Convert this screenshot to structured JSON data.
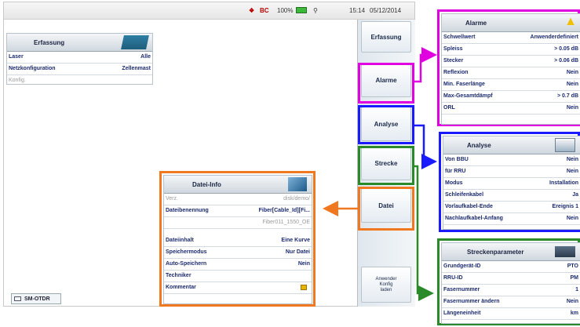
{
  "status": {
    "icons_text": "BC",
    "battery": "100%",
    "time": "15:14",
    "date": "05/12/2014"
  },
  "side_buttons": {
    "erfassung": "Erfassung",
    "alarme": "Alarme",
    "analyse": "Analyse",
    "strecke": "Strecke",
    "datei": "Datei",
    "anwender": "Anwender\nKonfig\nladen"
  },
  "erfassung_panel": {
    "title": "Erfassung",
    "rows": [
      {
        "k": "Laser",
        "v": "Alle"
      },
      {
        "k": "Netzkonfiguration",
        "v": "Zellenmast"
      },
      {
        "k": "Konfig.",
        "v": ""
      }
    ]
  },
  "datei_panel": {
    "title": "Datei-Info",
    "verz_label": "Verz.",
    "verz_value": "disk/demo/",
    "rows": [
      {
        "k": "Dateibenennung",
        "v": "Fiber[Cable_Id][Fi..."
      },
      {
        "k": "",
        "v": "Fiber011_1550_OE"
      },
      {
        "k": "Dateiinhalt",
        "v": "Eine Kurve"
      },
      {
        "k": "Speichermodus",
        "v": "Nur Datei"
      },
      {
        "k": "Auto-Speichern",
        "v": "Nein"
      },
      {
        "k": "Techniker",
        "v": ""
      },
      {
        "k": "Kommentar",
        "v": ""
      }
    ]
  },
  "alarme_panel": {
    "title": "Alarme",
    "rows": [
      {
        "k": "Schwellwert",
        "v": "Anwenderdefiniert"
      },
      {
        "k": "Spleiss",
        "v": "> 0.05 dB"
      },
      {
        "k": "Stecker",
        "v": "> 0.06 dB"
      },
      {
        "k": "Reflexion",
        "v": "Nein"
      },
      {
        "k": "Min. Faserlänge",
        "v": "Nein"
      },
      {
        "k": "Max-Gesamtdämpf",
        "v": "> 0.7 dB"
      },
      {
        "k": "ORL",
        "v": "Nein"
      }
    ]
  },
  "analyse_panel": {
    "title": "Analyse",
    "rows": [
      {
        "k": "Von BBU",
        "v": "Nein"
      },
      {
        "k": "für RRU",
        "v": "Nein"
      },
      {
        "k": "Modus",
        "v": "Installation"
      },
      {
        "k": "Schleifenkabel",
        "v": "Ja"
      },
      {
        "k": "Vorlaufkabel-Ende",
        "v": "Ereignis 1"
      },
      {
        "k": "Nachlaufkabel-Anfang",
        "v": "Nein"
      }
    ]
  },
  "strecke_panel": {
    "title": "Streckenparameter",
    "rows": [
      {
        "k": "Grundgerät-ID",
        "v": "PTO"
      },
      {
        "k": "RRU-ID",
        "v": "PM"
      },
      {
        "k": "Fasernummer",
        "v": "1"
      },
      {
        "k": "Fasernummer ändern",
        "v": "Nein"
      },
      {
        "k": "Längeneinheit",
        "v": "km"
      }
    ]
  },
  "bottom_tab": {
    "label": "SM-OTDR"
  },
  "colors": {
    "magenta": "#e000e0",
    "blue": "#1a1aff",
    "green": "#2a8a2a",
    "orange": "#f07820"
  }
}
